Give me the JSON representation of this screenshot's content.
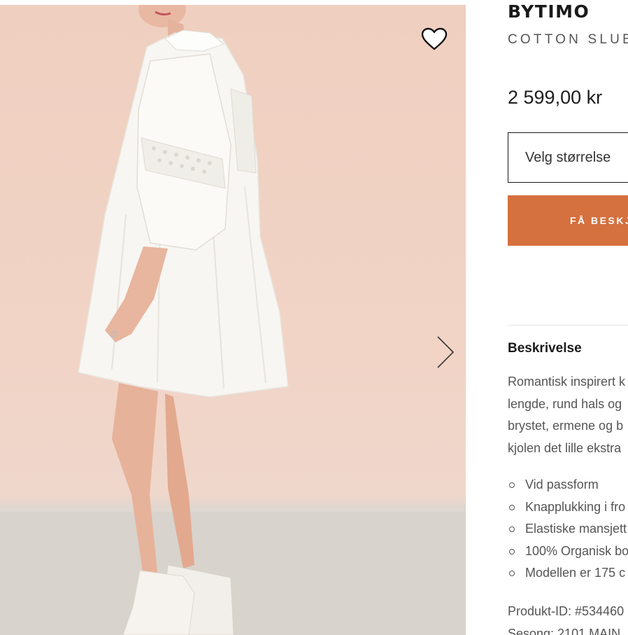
{
  "product": {
    "brand": "BYTIMO",
    "name": "COTTON SLUB",
    "price": "2 599,00 kr",
    "size_select_label": "Velg størrelse",
    "notify_button_label": "FÅ BESKJ"
  },
  "description": {
    "title": "Beskrivelse",
    "lines": [
      "Romantisk inspirert k",
      "lengde, rund hals og",
      "brystet, ermene og b",
      "kjolen det lille ekstra"
    ],
    "features": [
      "Vid passform",
      "Knapplukking i fro",
      "Elastiske mansjett",
      "100% Organisk bo",
      "Modellen er 175 c"
    ],
    "product_id": "Produkt-ID: #534460",
    "season": "Sesong: 2101 MAIN"
  },
  "gallery": {
    "favorite_icon": "heart-outline-icon",
    "next_icon": "chevron-right-icon"
  },
  "colors": {
    "accent": "#d5703f",
    "backdrop": "#f0d2c4",
    "floor": "#d9d4cd"
  }
}
